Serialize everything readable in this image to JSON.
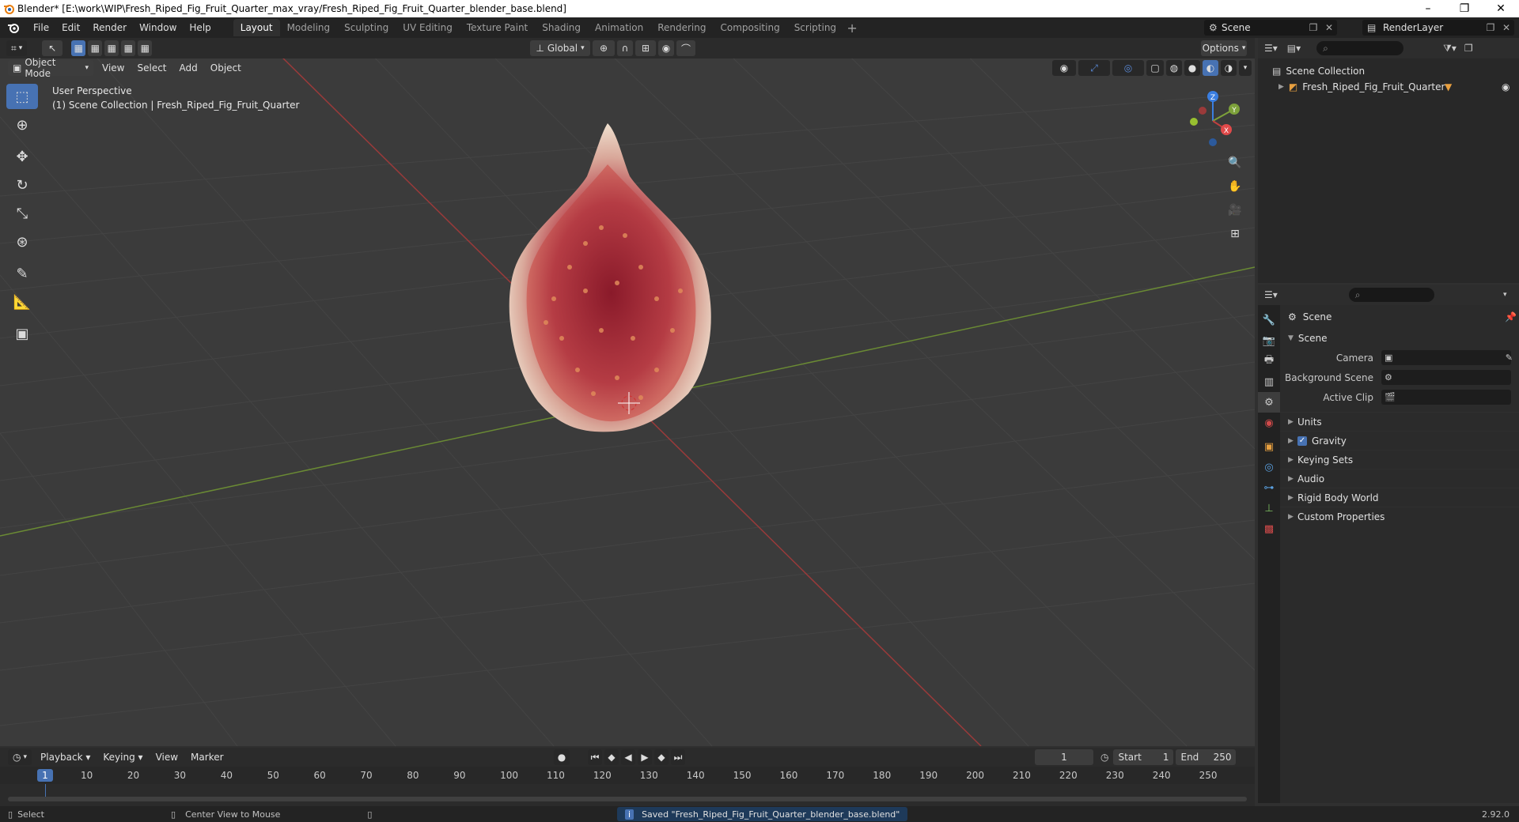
{
  "window": {
    "title": "Blender* [E:\\work\\WIP\\Fresh_Riped_Fig_Fruit_Quarter_max_vray/Fresh_Riped_Fig_Fruit_Quarter_blender_base.blend]",
    "minimize": "–",
    "maximize": "❐",
    "close": "✕"
  },
  "menubar": {
    "items": [
      "File",
      "Edit",
      "Render",
      "Window",
      "Help"
    ],
    "workspaces": [
      "Layout",
      "Modeling",
      "Sculpting",
      "UV Editing",
      "Texture Paint",
      "Shading",
      "Animation",
      "Rendering",
      "Compositing",
      "Scripting"
    ],
    "active_workspace": "Layout",
    "add_workspace": "+",
    "scene_name": "Scene",
    "render_layer": "RenderLayer"
  },
  "viewport": {
    "transform_orientation": "Global",
    "options_label": "Options",
    "mode": "Object Mode",
    "menus": [
      "View",
      "Select",
      "Add",
      "Object"
    ],
    "perspective_label": "User Perspective",
    "collection_label": "(1) Scene Collection | Fresh_Riped_Fig_Fruit_Quarter",
    "gizmo_axes": {
      "x": "X",
      "y": "Y",
      "z": "Z"
    }
  },
  "outliner": {
    "search_placeholder": "",
    "root": "Scene Collection",
    "items": [
      {
        "name": "Fresh_Riped_Fig_Fruit_Quarter"
      }
    ]
  },
  "properties": {
    "title": "Scene",
    "section": "Scene",
    "fields": [
      {
        "label": "Camera",
        "value": ""
      },
      {
        "label": "Background Scene",
        "value": ""
      },
      {
        "label": "Active Clip",
        "value": ""
      }
    ],
    "panels": [
      "Units",
      "Gravity",
      "Keying Sets",
      "Audio",
      "Rigid Body World",
      "Custom Properties"
    ],
    "gravity_checked": true
  },
  "timeline": {
    "menus": [
      "Playback",
      "Keying",
      "View",
      "Marker"
    ],
    "current_frame": "1",
    "start_label": "Start",
    "start_value": "1",
    "end_label": "End",
    "end_value": "250",
    "ticks": [
      "10",
      "20",
      "30",
      "40",
      "50",
      "60",
      "70",
      "80",
      "90",
      "100",
      "110",
      "120",
      "130",
      "140",
      "150",
      "160",
      "170",
      "180",
      "190",
      "200",
      "210",
      "220",
      "230",
      "240",
      "250"
    ],
    "cursor_frame": "1"
  },
  "statusbar": {
    "select": "Select",
    "center_view": "Center View to Mouse",
    "message": "Saved \"Fresh_Riped_Fig_Fruit_Quarter_blender_base.blend\"",
    "version": "2.92.0"
  },
  "colors": {
    "accent": "#4772b3",
    "x_axis": "#c0403f",
    "y_axis": "#7da13a",
    "z_axis": "#3a7ee0"
  }
}
